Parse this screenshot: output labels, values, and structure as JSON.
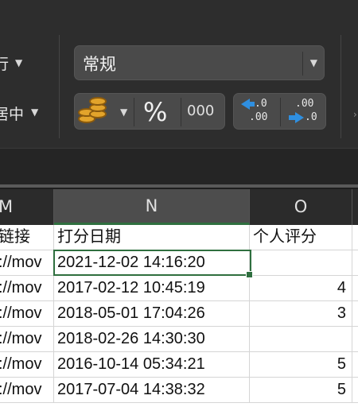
{
  "ribbon": {
    "wrap_partial": "行",
    "merge_partial": "居中",
    "number_format": "常规",
    "percent": "%",
    "thousands": "000",
    "increase_decimal_top": ".0",
    "increase_decimal_bottom": ".00",
    "decrease_decimal_top": ".00",
    "decrease_decimal_bottom": ".0"
  },
  "grid": {
    "columns": [
      {
        "letter": "M"
      },
      {
        "letter": "N"
      },
      {
        "letter": "O"
      }
    ],
    "header_row": [
      "链接",
      "打分日期",
      "个人评分"
    ],
    "rows": [
      [
        "://mov",
        "2021-12-02 14:16:20",
        ""
      ],
      [
        "://mov",
        "2017-02-12 10:45:19",
        "4"
      ],
      [
        "://mov",
        "2018-05-01 17:04:26",
        "3"
      ],
      [
        "://mov",
        "2018-02-26 14:30:30",
        ""
      ],
      [
        "://mov",
        "2016-10-14 05:34:21",
        "5"
      ],
      [
        "://mov",
        "2017-07-04 14:38:32",
        "5"
      ]
    ]
  }
}
